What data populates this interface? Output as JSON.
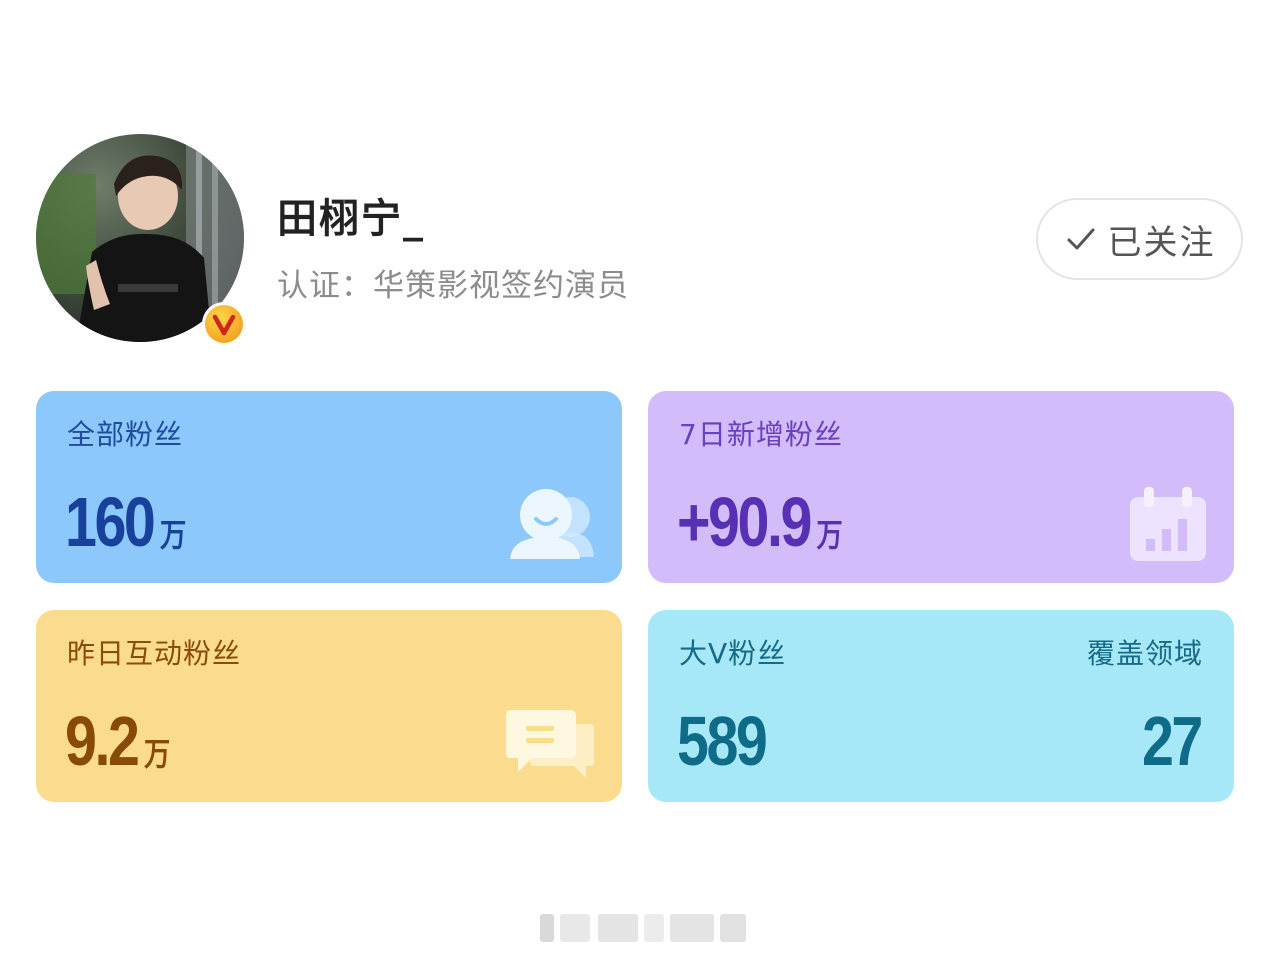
{
  "profile": {
    "username": "田栩宁_",
    "certification": "认证：华策影视签约演员",
    "follow_label": "已关注"
  },
  "cards": {
    "all_fans": {
      "title": "全部粉丝",
      "value": "160",
      "unit": "万",
      "icon": "fans-icon"
    },
    "new_fans_7d": {
      "title": "7日新增粉丝",
      "value": "+90.9",
      "unit": "万",
      "icon": "calendar-chart-icon"
    },
    "interactive_fans": {
      "title": "昨日互动粉丝",
      "value": "9.2",
      "unit": "万",
      "icon": "chat-icon"
    },
    "big_v_fans": {
      "title": "大V粉丝",
      "value": "589",
      "coverage_title": "覆盖领域",
      "coverage_value": "27"
    }
  },
  "colors": {
    "blue_card": "#8cc8fb",
    "purple_card": "#d2bdfa",
    "yellow_card": "#fbdc8f",
    "cyan_card": "#a7e8f8",
    "badge": "#f5a623"
  }
}
